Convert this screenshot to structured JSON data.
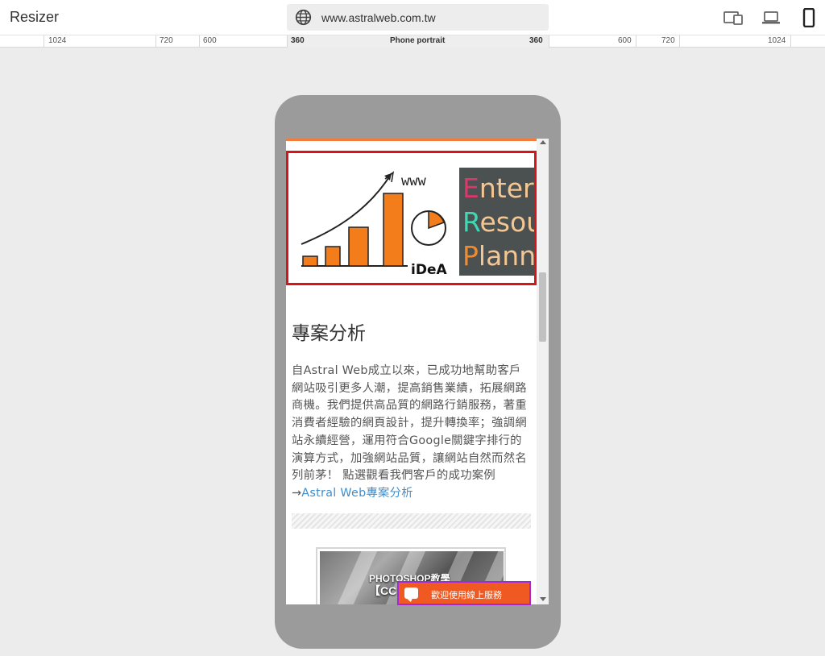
{
  "app": {
    "title": "Resizer"
  },
  "urlbar": {
    "url": "www.astralweb.com.tw"
  },
  "device_buttons": [
    "tablet-icon",
    "laptop-icon",
    "phone-icon"
  ],
  "ruler": {
    "left_labels": [
      "1024",
      "720",
      "600",
      "360"
    ],
    "center_label": "Phone portrait",
    "right_labels": [
      "360",
      "600",
      "720",
      "1024"
    ]
  },
  "banner": {
    "idea_text": "iDeA",
    "www_text": "www",
    "erp_lines": [
      {
        "first": "E",
        "rest": "nter",
        "first_color": "#e0346a"
      },
      {
        "first": "R",
        "rest": "esou",
        "first_color": "#3fd8b5"
      },
      {
        "first": "P",
        "rest": "lann",
        "first_color": "#f08a2e"
      }
    ]
  },
  "article": {
    "title": "專案分析",
    "body": "自Astral Web成立以來，已成功地幫助客戶網站吸引更多人潮，提高銷售業績，拓展網路商機。我們提供高品質的網路行銷服務，著重消費者經驗的網頁設計，提升轉換率；強調網站永續經營，運用符合Google關鍵字排行的演算方式，加強網站品質，讓網站自然而然名列前茅！ 點選觀看我們客戶的成功案例→",
    "link": "Astral Web專案分析"
  },
  "thumbnail": {
    "line1": "PHOTOSHOP教學",
    "line2": "【CC"
  },
  "chat": {
    "label": "歡迎使用線上服務"
  },
  "colors": {
    "accent": "#f47b3b",
    "banner_border": "#d81418",
    "chat_bg": "#f05a22",
    "chat_border": "#a12ad6",
    "link": "#3d8fd1"
  }
}
